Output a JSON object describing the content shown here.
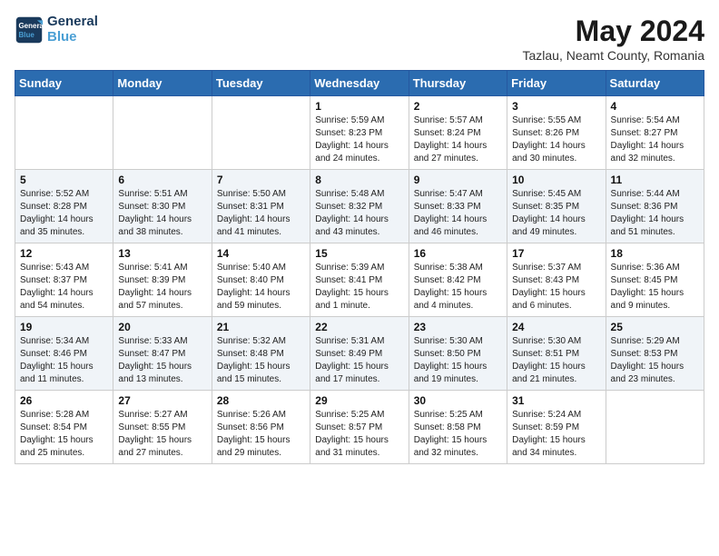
{
  "header": {
    "logo_line1": "General",
    "logo_line2": "Blue",
    "month_year": "May 2024",
    "location": "Tazlau, Neamt County, Romania"
  },
  "days_of_week": [
    "Sunday",
    "Monday",
    "Tuesday",
    "Wednesday",
    "Thursday",
    "Friday",
    "Saturday"
  ],
  "weeks": [
    [
      {
        "day": "",
        "content": ""
      },
      {
        "day": "",
        "content": ""
      },
      {
        "day": "",
        "content": ""
      },
      {
        "day": "1",
        "content": "Sunrise: 5:59 AM\nSunset: 8:23 PM\nDaylight: 14 hours\nand 24 minutes."
      },
      {
        "day": "2",
        "content": "Sunrise: 5:57 AM\nSunset: 8:24 PM\nDaylight: 14 hours\nand 27 minutes."
      },
      {
        "day": "3",
        "content": "Sunrise: 5:55 AM\nSunset: 8:26 PM\nDaylight: 14 hours\nand 30 minutes."
      },
      {
        "day": "4",
        "content": "Sunrise: 5:54 AM\nSunset: 8:27 PM\nDaylight: 14 hours\nand 32 minutes."
      }
    ],
    [
      {
        "day": "5",
        "content": "Sunrise: 5:52 AM\nSunset: 8:28 PM\nDaylight: 14 hours\nand 35 minutes."
      },
      {
        "day": "6",
        "content": "Sunrise: 5:51 AM\nSunset: 8:30 PM\nDaylight: 14 hours\nand 38 minutes."
      },
      {
        "day": "7",
        "content": "Sunrise: 5:50 AM\nSunset: 8:31 PM\nDaylight: 14 hours\nand 41 minutes."
      },
      {
        "day": "8",
        "content": "Sunrise: 5:48 AM\nSunset: 8:32 PM\nDaylight: 14 hours\nand 43 minutes."
      },
      {
        "day": "9",
        "content": "Sunrise: 5:47 AM\nSunset: 8:33 PM\nDaylight: 14 hours\nand 46 minutes."
      },
      {
        "day": "10",
        "content": "Sunrise: 5:45 AM\nSunset: 8:35 PM\nDaylight: 14 hours\nand 49 minutes."
      },
      {
        "day": "11",
        "content": "Sunrise: 5:44 AM\nSunset: 8:36 PM\nDaylight: 14 hours\nand 51 minutes."
      }
    ],
    [
      {
        "day": "12",
        "content": "Sunrise: 5:43 AM\nSunset: 8:37 PM\nDaylight: 14 hours\nand 54 minutes."
      },
      {
        "day": "13",
        "content": "Sunrise: 5:41 AM\nSunset: 8:39 PM\nDaylight: 14 hours\nand 57 minutes."
      },
      {
        "day": "14",
        "content": "Sunrise: 5:40 AM\nSunset: 8:40 PM\nDaylight: 14 hours\nand 59 minutes."
      },
      {
        "day": "15",
        "content": "Sunrise: 5:39 AM\nSunset: 8:41 PM\nDaylight: 15 hours\nand 1 minute."
      },
      {
        "day": "16",
        "content": "Sunrise: 5:38 AM\nSunset: 8:42 PM\nDaylight: 15 hours\nand 4 minutes."
      },
      {
        "day": "17",
        "content": "Sunrise: 5:37 AM\nSunset: 8:43 PM\nDaylight: 15 hours\nand 6 minutes."
      },
      {
        "day": "18",
        "content": "Sunrise: 5:36 AM\nSunset: 8:45 PM\nDaylight: 15 hours\nand 9 minutes."
      }
    ],
    [
      {
        "day": "19",
        "content": "Sunrise: 5:34 AM\nSunset: 8:46 PM\nDaylight: 15 hours\nand 11 minutes."
      },
      {
        "day": "20",
        "content": "Sunrise: 5:33 AM\nSunset: 8:47 PM\nDaylight: 15 hours\nand 13 minutes."
      },
      {
        "day": "21",
        "content": "Sunrise: 5:32 AM\nSunset: 8:48 PM\nDaylight: 15 hours\nand 15 minutes."
      },
      {
        "day": "22",
        "content": "Sunrise: 5:31 AM\nSunset: 8:49 PM\nDaylight: 15 hours\nand 17 minutes."
      },
      {
        "day": "23",
        "content": "Sunrise: 5:30 AM\nSunset: 8:50 PM\nDaylight: 15 hours\nand 19 minutes."
      },
      {
        "day": "24",
        "content": "Sunrise: 5:30 AM\nSunset: 8:51 PM\nDaylight: 15 hours\nand 21 minutes."
      },
      {
        "day": "25",
        "content": "Sunrise: 5:29 AM\nSunset: 8:53 PM\nDaylight: 15 hours\nand 23 minutes."
      }
    ],
    [
      {
        "day": "26",
        "content": "Sunrise: 5:28 AM\nSunset: 8:54 PM\nDaylight: 15 hours\nand 25 minutes."
      },
      {
        "day": "27",
        "content": "Sunrise: 5:27 AM\nSunset: 8:55 PM\nDaylight: 15 hours\nand 27 minutes."
      },
      {
        "day": "28",
        "content": "Sunrise: 5:26 AM\nSunset: 8:56 PM\nDaylight: 15 hours\nand 29 minutes."
      },
      {
        "day": "29",
        "content": "Sunrise: 5:25 AM\nSunset: 8:57 PM\nDaylight: 15 hours\nand 31 minutes."
      },
      {
        "day": "30",
        "content": "Sunrise: 5:25 AM\nSunset: 8:58 PM\nDaylight: 15 hours\nand 32 minutes."
      },
      {
        "day": "31",
        "content": "Sunrise: 5:24 AM\nSunset: 8:59 PM\nDaylight: 15 hours\nand 34 minutes."
      },
      {
        "day": "",
        "content": ""
      }
    ]
  ]
}
